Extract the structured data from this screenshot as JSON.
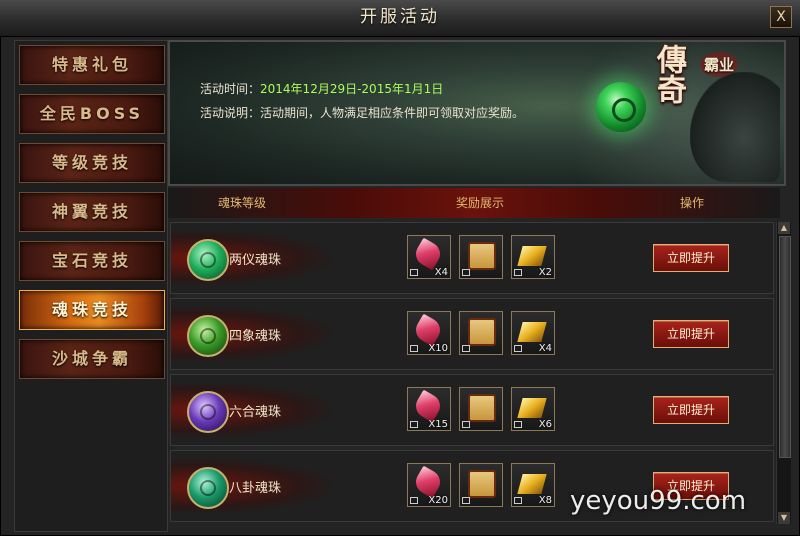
{
  "window": {
    "title": "开服活动",
    "close_label": "X"
  },
  "sidebar": {
    "items": [
      {
        "label": "特惠礼包",
        "active": false
      },
      {
        "label": "全民BOSS",
        "active": false
      },
      {
        "label": "等级竞技",
        "active": false
      },
      {
        "label": "神翼竞技",
        "active": false
      },
      {
        "label": "宝石竞技",
        "active": false
      },
      {
        "label": "魂珠竞技",
        "active": true
      },
      {
        "label": "沙城争霸",
        "active": false
      }
    ]
  },
  "banner": {
    "logo_big": "傳奇",
    "logo_small": "霸业",
    "time_label": "活动时间：",
    "time_value": "2014年12月29日-2015年1月1日",
    "desc_label": "活动说明：",
    "desc_value": "活动期间，人物满足相应条件即可领取对应奖励。"
  },
  "table": {
    "headers": {
      "level": "魂珠等级",
      "rewards": "奖励展示",
      "action": "操作"
    },
    "rows": [
      {
        "name": "两仪魂珠",
        "orb_color": "#1fae5a",
        "rewards": [
          "X4",
          "",
          "X2"
        ],
        "button": "立即提升"
      },
      {
        "name": "四象魂珠",
        "orb_color": "#3a9a28",
        "rewards": [
          "X10",
          "",
          "X4"
        ],
        "button": "立即提升"
      },
      {
        "name": "六合魂珠",
        "orb_color": "#6a3ab8",
        "rewards": [
          "X15",
          "",
          "X6"
        ],
        "button": "立即提升"
      },
      {
        "name": "八卦魂珠",
        "orb_color": "#1a9a6a",
        "rewards": [
          "X20",
          "",
          "X8"
        ],
        "button": "立即提升"
      }
    ]
  },
  "watermark": "yeyou99.com"
}
